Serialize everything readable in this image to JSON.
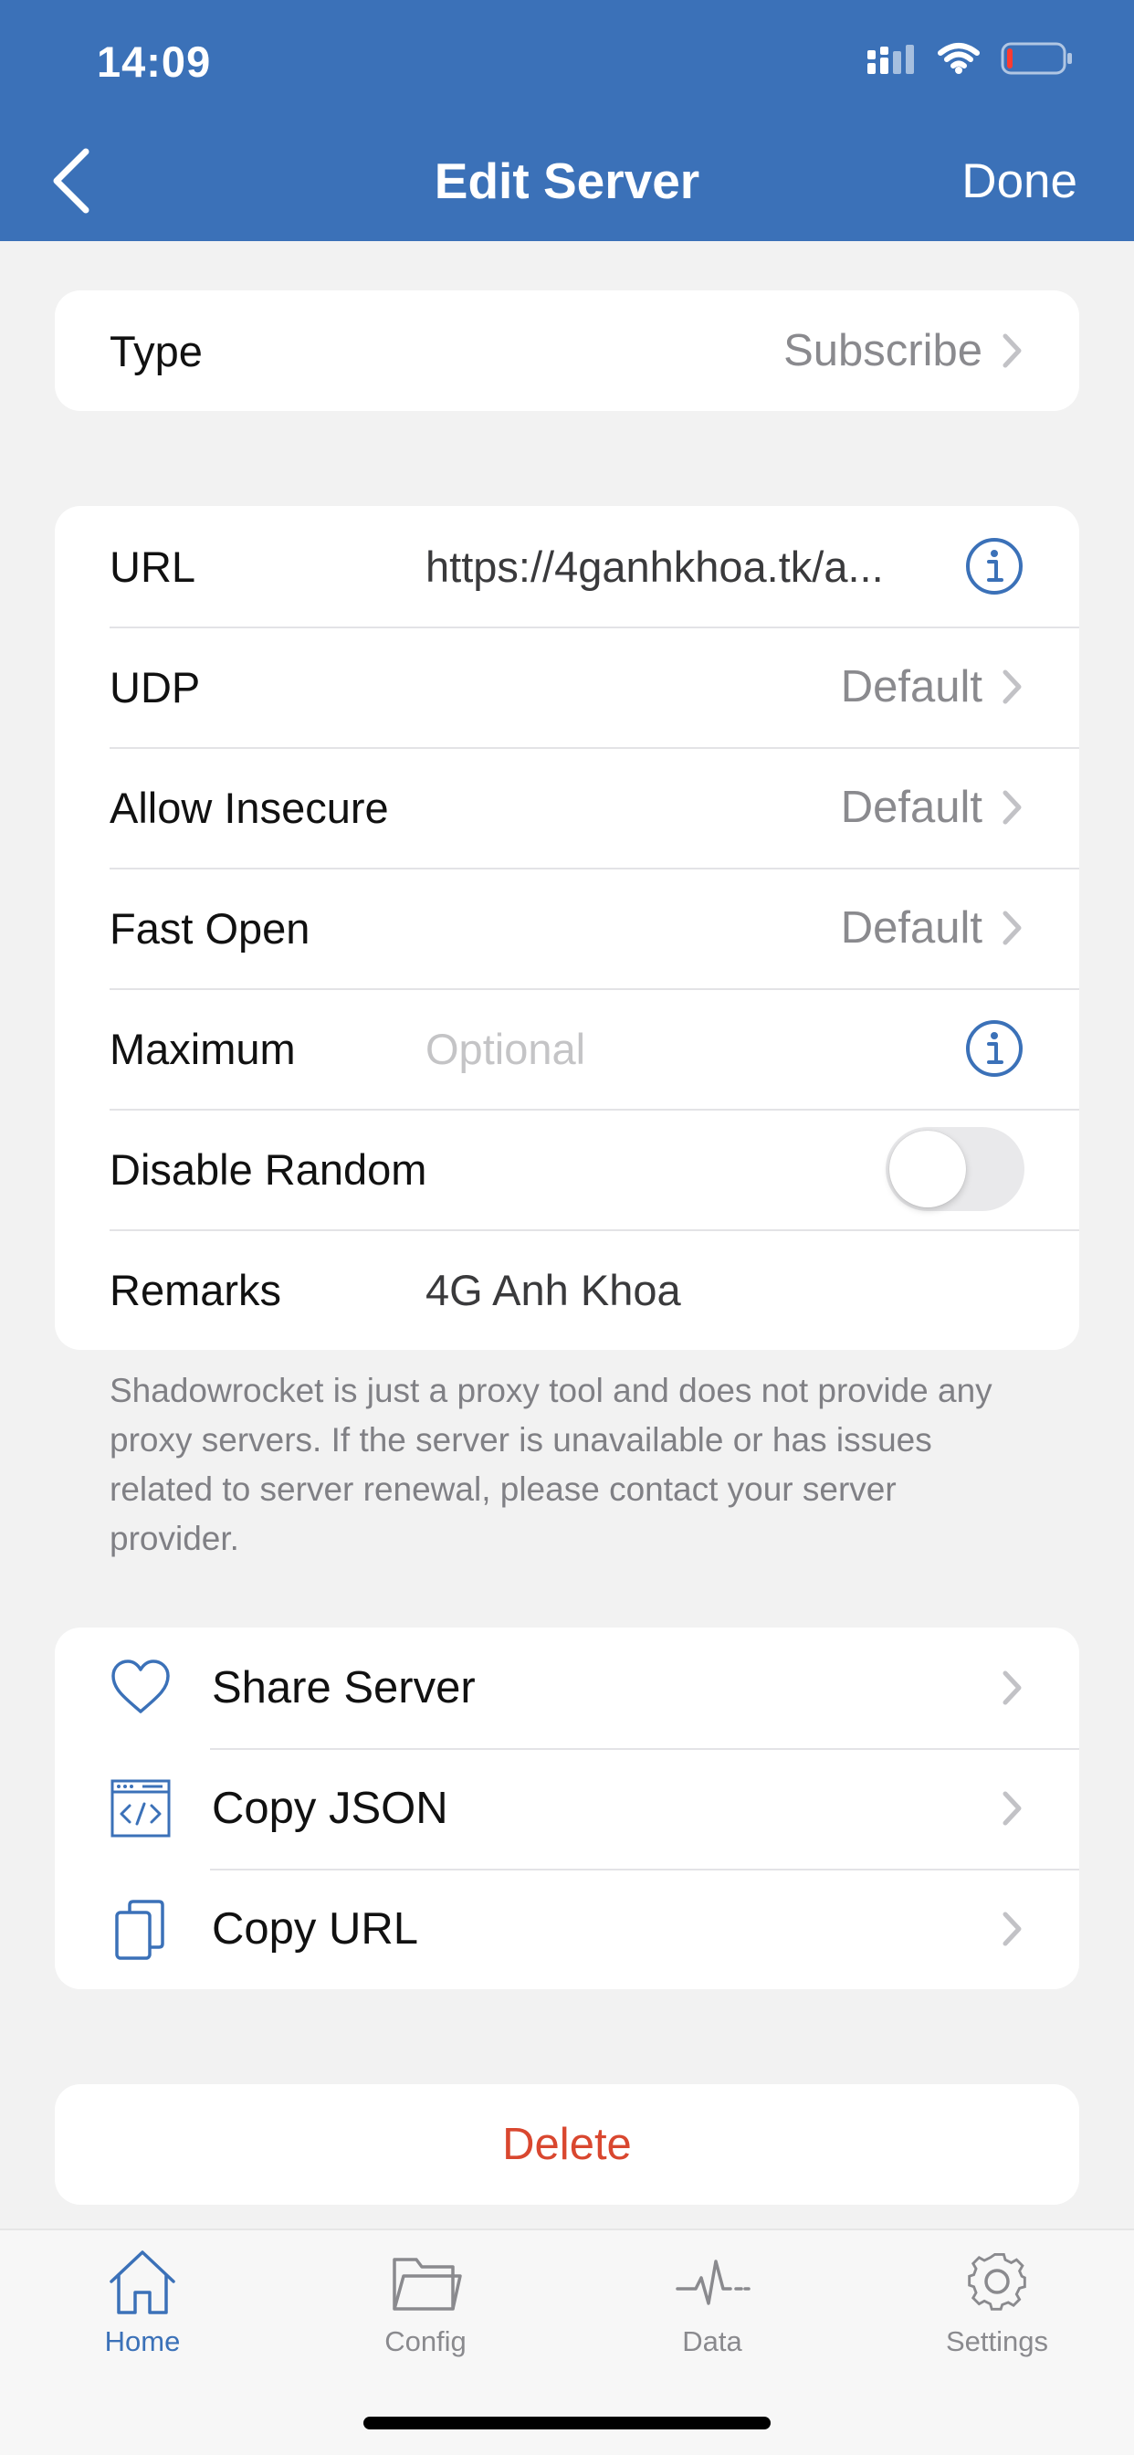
{
  "status_bar": {
    "time": "14:09"
  },
  "nav": {
    "title": "Edit Server",
    "done_label": "Done",
    "back_icon": "chevron-left-icon"
  },
  "type_card": {
    "label": "Type",
    "value": "Subscribe"
  },
  "settings": {
    "url": {
      "label": "URL",
      "value": "https://4ganhkhoa.tk/a..."
    },
    "udp": {
      "label": "UDP",
      "value": "Default"
    },
    "allow_insecure": {
      "label": "Allow Insecure",
      "value": "Default"
    },
    "fast_open": {
      "label": "Fast Open",
      "value": "Default"
    },
    "maximum": {
      "label": "Maximum",
      "placeholder": "Optional"
    },
    "disable_random": {
      "label": "Disable Random",
      "enabled": false
    },
    "remarks": {
      "label": "Remarks",
      "value": "4G Anh Khoa"
    }
  },
  "footnote": "Shadowrocket is just a proxy tool and does not provide any proxy servers. If the server is unavailable or has issues related to server renewal, please contact your server provider.",
  "actions": [
    {
      "label": "Share Server",
      "icon": "heart-icon"
    },
    {
      "label": "Copy JSON",
      "icon": "code-window-icon"
    },
    {
      "label": "Copy URL",
      "icon": "copy-icon"
    }
  ],
  "delete_label": "Delete",
  "tabbar": {
    "home": "Home",
    "config": "Config",
    "data": "Data",
    "settings": "Settings",
    "active": "home"
  },
  "colors": {
    "accent": "#3b71b8",
    "destructive": "#d9472f",
    "background": "#f2f2f2"
  }
}
